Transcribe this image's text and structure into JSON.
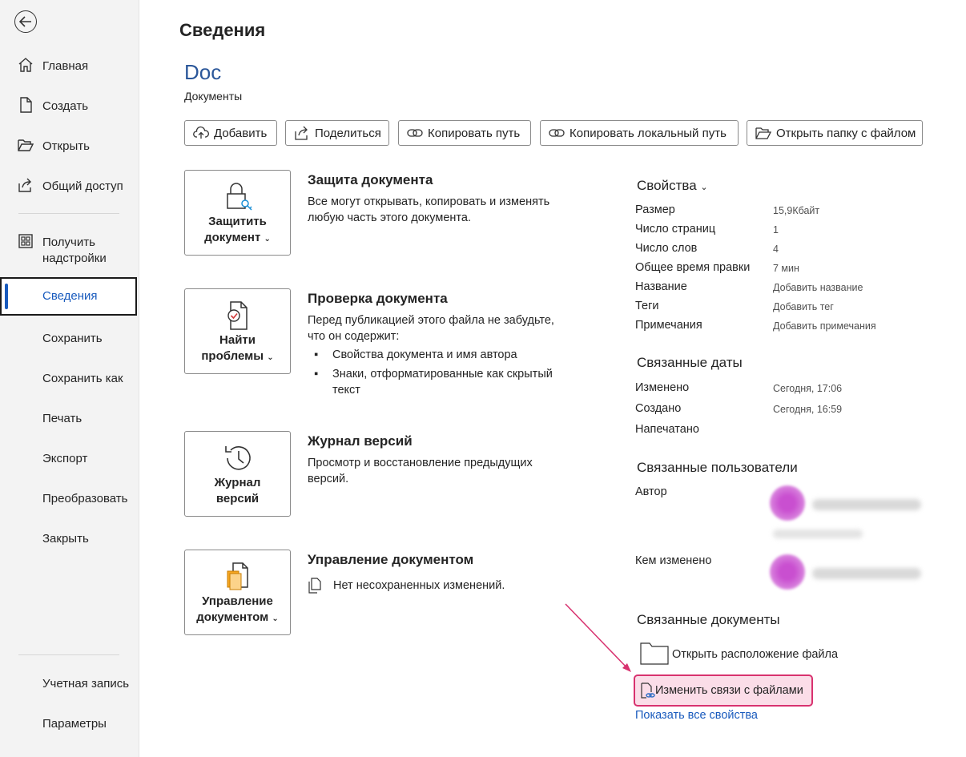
{
  "sidebar": {
    "items": [
      {
        "label": "Главная",
        "icon": "home-icon"
      },
      {
        "label": "Создать",
        "icon": "new-document-icon"
      },
      {
        "label": "Открыть",
        "icon": "folder-open-icon"
      },
      {
        "label": "Общий доступ",
        "icon": "share-icon"
      },
      {
        "label": "Получить надстройки",
        "icon": "addins-grid-icon"
      },
      {
        "label": "Сведения"
      },
      {
        "label": "Сохранить"
      },
      {
        "label": "Сохранить как"
      },
      {
        "label": "Печать"
      },
      {
        "label": "Экспорт"
      },
      {
        "label": "Преобразовать"
      },
      {
        "label": "Закрыть"
      },
      {
        "label": "Учетная запись"
      },
      {
        "label": "Параметры"
      }
    ],
    "get_addins_line1": "Получить",
    "get_addins_line2": "надстройки",
    "active_item": "Сведения",
    "accent": "#185abd"
  },
  "page": {
    "title": "Сведения",
    "doc_name": "Doc",
    "doc_location": "Документы"
  },
  "toolbar": {
    "add": "Добавить",
    "share": "Поделиться",
    "copy_path": "Копировать путь",
    "copy_local_path": "Копировать локальный путь",
    "open_folder": "Открыть папку с файлом"
  },
  "sections": {
    "protect": {
      "button_line1": "Защитить",
      "button_line2": "документ",
      "title": "Защита документа",
      "text": "Все могут открывать, копировать и изменять любую часть этого документа."
    },
    "inspect": {
      "button_line1": "Найти",
      "button_line2": "проблемы",
      "title": "Проверка документа",
      "text": "Перед публикацией этого файла не забудьте, что он содержит:",
      "bullets": [
        "Свойства документа и имя автора",
        "Знаки, отформатированные как скрытый текст"
      ]
    },
    "versions": {
      "button_line1": "Журнал",
      "button_line2": "версий",
      "title": "Журнал версий",
      "text": "Просмотр и восстановление предыдущих версий."
    },
    "manage": {
      "button_line1": "Управление",
      "button_line2": "документом",
      "title": "Управление документом",
      "text": "Нет несохраненных изменений."
    }
  },
  "properties": {
    "header": "Свойства",
    "rows": [
      {
        "key": "Размер",
        "value": "15,9Кбайт"
      },
      {
        "key": "Число страниц",
        "value": "1"
      },
      {
        "key": "Число слов",
        "value": "4"
      },
      {
        "key": "Общее время правки",
        "value": "7 мин"
      },
      {
        "key": "Название",
        "value": "Добавить название"
      },
      {
        "key": "Теги",
        "value": "Добавить тег"
      },
      {
        "key": "Примечания",
        "value": "Добавить примечания"
      }
    ]
  },
  "dates": {
    "header": "Связанные даты",
    "rows": [
      {
        "key": "Изменено",
        "value": "Сегодня, 17:06"
      },
      {
        "key": "Создано",
        "value": "Сегодня, 16:59"
      },
      {
        "key": "Напечатано",
        "value": ""
      }
    ]
  },
  "people": {
    "header": "Связанные пользователи",
    "author_label": "Автор",
    "modified_by_label": "Кем изменено"
  },
  "related_docs": {
    "header": "Связанные документы",
    "open_location": "Открыть расположение файла",
    "edit_links": "Изменить связи с файлами",
    "show_all": "Показать все свойства",
    "highlight_color": "#d8326f"
  }
}
